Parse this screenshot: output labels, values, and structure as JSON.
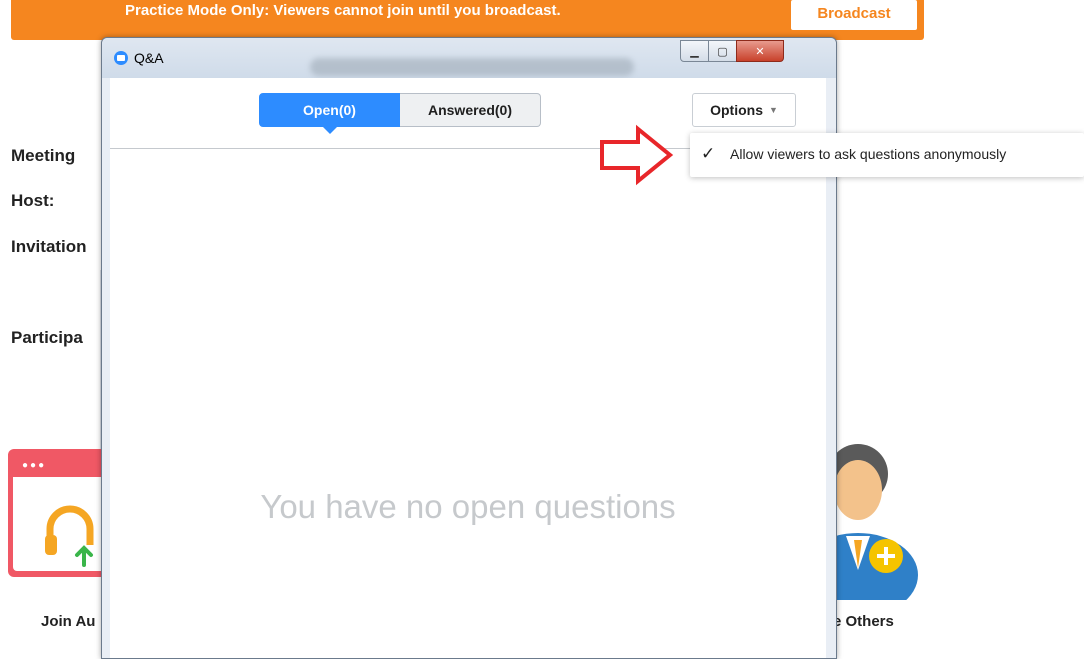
{
  "background": {
    "banner_text": "Practice Mode Only: Viewers cannot join until you broadcast.",
    "broadcast_button": "Broadcast",
    "labels": [
      "Meeting",
      "Host:",
      "Invitation",
      "Participa"
    ],
    "join_audio_caption": "Join Au",
    "invite_caption": "e Others",
    "colors": {
      "banner": "#f5861f",
      "audio_tile": "#f05865",
      "accent": "#2d8cff"
    },
    "icons": [
      "headphones-icon",
      "arrow-up-icon",
      "invite-person-icon",
      "plus-icon"
    ]
  },
  "window": {
    "title": "Q&A",
    "controls": [
      "minimize",
      "maximize",
      "close"
    ]
  },
  "tabs": [
    {
      "label": "Open(0)",
      "active": true
    },
    {
      "label": "Answered(0)",
      "active": false
    }
  ],
  "options": {
    "label": "Options",
    "menu_items": [
      {
        "label": "Allow viewers to ask questions anonymously",
        "checked": true
      }
    ]
  },
  "empty_state": "You have no open questions"
}
